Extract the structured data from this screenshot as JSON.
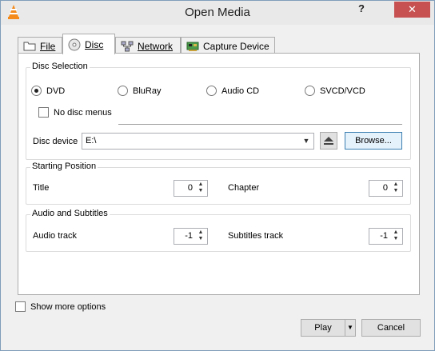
{
  "window": {
    "title": "Open Media",
    "help_label": "?",
    "close_label": "✕"
  },
  "tabs": [
    {
      "label": "File",
      "icon": "folder-icon",
      "underline_index": 0
    },
    {
      "label": "Disc",
      "icon": "disc-icon",
      "underline_index": 0
    },
    {
      "label": "Network",
      "icon": "network-icon",
      "underline_index": 0
    },
    {
      "label": "Capture Device",
      "icon": "capture-card-icon",
      "underline_index": 8
    }
  ],
  "active_tab": "Disc",
  "disc_selection": {
    "title": "Disc Selection",
    "options": [
      "DVD",
      "BluRay",
      "Audio CD",
      "SVCD/VCD"
    ],
    "selected": "DVD",
    "no_disc_menus_label": "No disc menus",
    "disc_device_label": "Disc device",
    "disc_device_value": "E:\\",
    "browse_label": "Browse..."
  },
  "starting_position": {
    "title": "Starting Position",
    "title_label": "Title",
    "title_value": "0",
    "chapter_label": "Chapter",
    "chapter_value": "0"
  },
  "audio_subtitles": {
    "title": "Audio and Subtitles",
    "audio_track_label": "Audio track",
    "audio_track_value": "-1",
    "subtitles_track_label": "Subtitles track",
    "subtitles_track_value": "-1"
  },
  "footer": {
    "show_more_label": "Show more options",
    "play_label": "Play",
    "cancel_label": "Cancel"
  },
  "colors": {
    "close_button": "#c75050",
    "focus_border": "#3c7fb1"
  }
}
